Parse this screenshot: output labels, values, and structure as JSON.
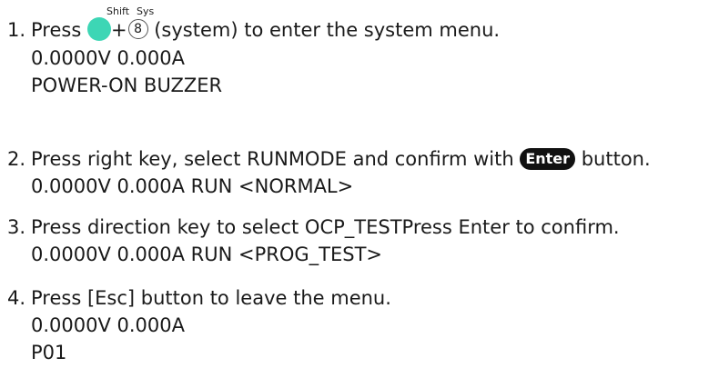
{
  "steps": [
    {
      "number": "1.",
      "pre": "Press ",
      "key1_label": "Shift",
      "plus": "+",
      "key2_label": "Sys",
      "key2_value": "8",
      "post": " (system) to enter the system menu.",
      "display_lines": [
        "0.0000V 0.000A",
        "POWER-ON BUZZER"
      ]
    },
    {
      "number": "2.",
      "pre": "Press right key, select RUNMODE and confirm with ",
      "enter_label": "Enter",
      "post": " button.",
      "display_lines": [
        "0.0000V 0.000A RUN <NORMAL>"
      ]
    },
    {
      "number": "3.",
      "text": "Press direction key to select OCP_TESTPress Enter to confirm.",
      "display_lines": [
        "0.0000V 0.000A RUN <PROG_TEST>"
      ]
    },
    {
      "number": "4.",
      "text": "Press [Esc] button to leave the menu.",
      "display_lines": [
        "0.0000V 0.000A",
        "P01"
      ]
    }
  ],
  "colors": {
    "shift_key": "#3dd6b5",
    "enter_key": "#111111"
  }
}
